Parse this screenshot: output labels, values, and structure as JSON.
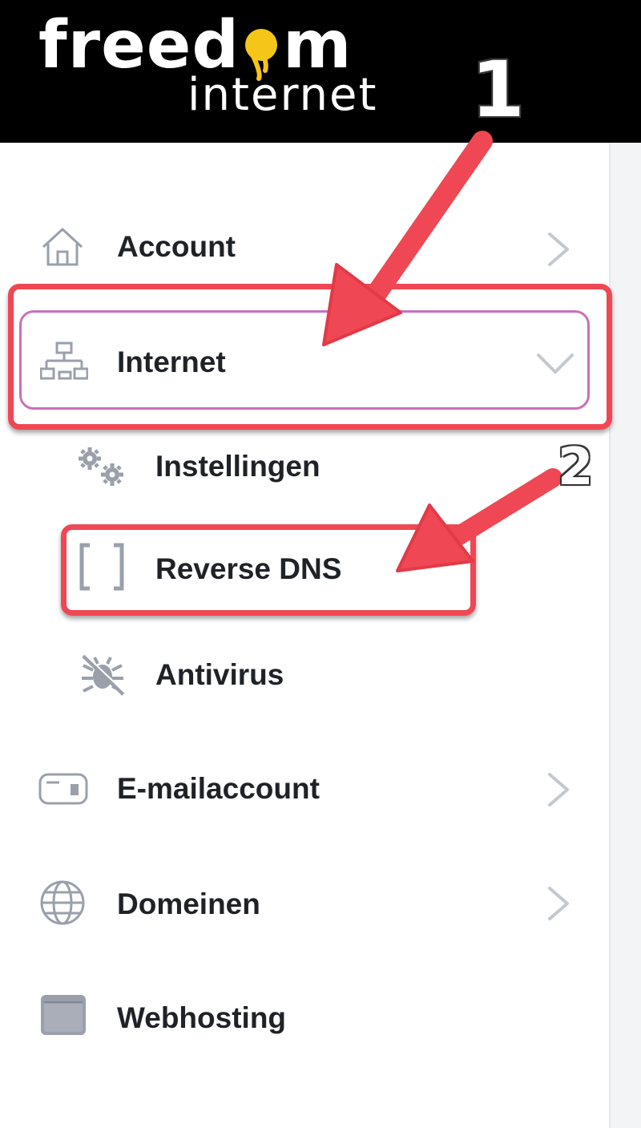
{
  "logo": {
    "brand": "freedom",
    "brand_before": "freed",
    "brand_after": "m",
    "sub": "internet"
  },
  "nav": {
    "account": {
      "label": "Account",
      "icon": "home-icon"
    },
    "internet": {
      "label": "Internet",
      "icon": "network-icon",
      "expanded": true
    },
    "instellingen": {
      "label": "Instellingen",
      "icon": "gears-icon"
    },
    "reverse_dns": {
      "label": "Reverse DNS",
      "icon": "brackets-icon"
    },
    "antivirus": {
      "label": "Antivirus",
      "icon": "bug-off-icon"
    },
    "emailaccount": {
      "label": "E-mailaccount",
      "icon": "mailbox-icon"
    },
    "domeinen": {
      "label": "Domeinen",
      "icon": "globe-icon"
    },
    "webhosting": {
      "label": "Webhosting",
      "icon": "browser-window-icon"
    }
  },
  "annotations": {
    "step1": "1",
    "step2": "2"
  },
  "colors": {
    "header_bg": "#000000",
    "logo_accent": "#f5c518",
    "callout": "#ef4753",
    "active_border": "#c96ec0",
    "icon_gray": "#9aa0ab",
    "chevron_gray": "#c4c8cf"
  }
}
